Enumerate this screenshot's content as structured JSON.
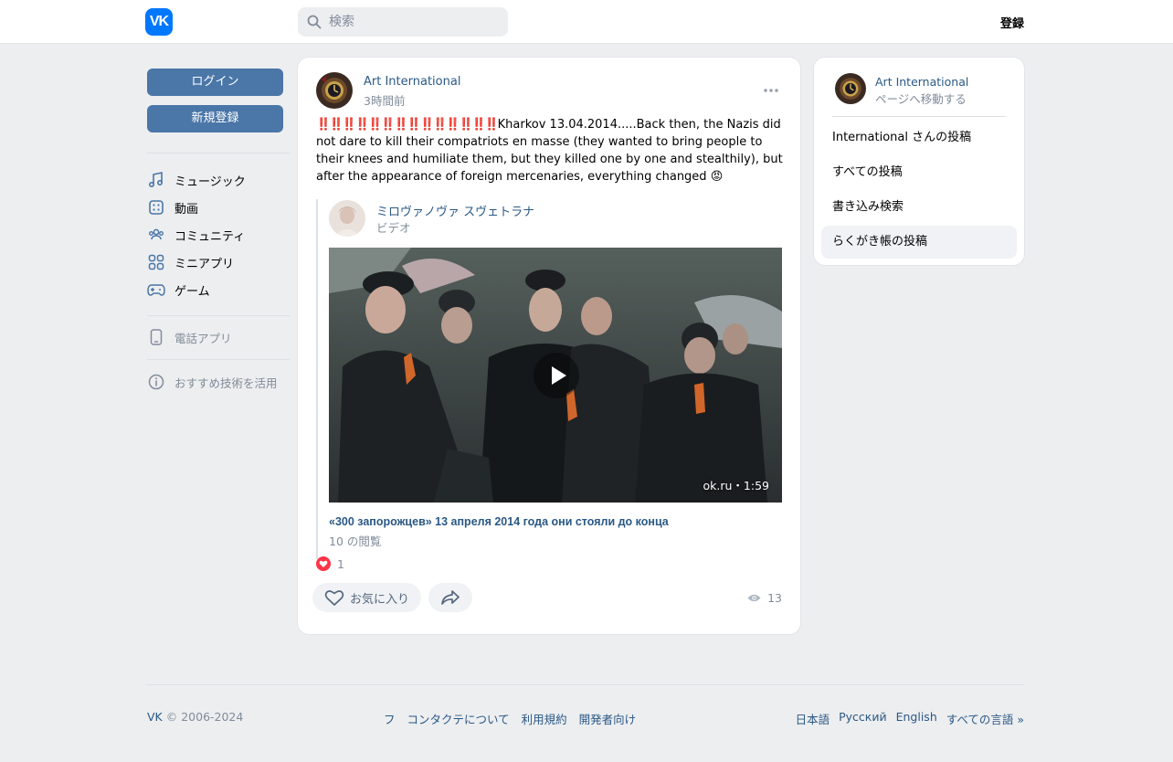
{
  "header": {
    "logo_text": "VK",
    "search_placeholder": "検索",
    "register_label": "登録"
  },
  "left_nav": {
    "login_label": "ログイン",
    "signup_label": "新規登録",
    "items": [
      {
        "label": "ミュージック",
        "icon": "music-icon"
      },
      {
        "label": "動画",
        "icon": "video-icon"
      },
      {
        "label": "コミュニティ",
        "icon": "community-icon"
      },
      {
        "label": "ミニアプリ",
        "icon": "mini-apps-icon"
      },
      {
        "label": "ゲーム",
        "icon": "gamepad-icon"
      }
    ],
    "phone_app_label": "電話アプリ",
    "recommend_label": "おすすめ技術を活用"
  },
  "post": {
    "author": "Art International",
    "time": "3時間前",
    "bangs": "‼️‼️‼️‼️‼️‼️‼️‼️‼️‼️‼️‼️‼️‼️",
    "text": "Kharkov 13.04.2014.....Back then, the Nazis did not dare to kill their compatriots en masse (they wanted to bring people to their knees and humiliate them, but they killed one by one and stealthily), but after the appearance of foreign mercenaries, everything changed",
    "angry_emoji": "😡",
    "repost": {
      "author": "ミロヴァノヴァ スヴェトラナ",
      "subtitle": "ビデオ"
    },
    "video": {
      "meta": "ok.ru・1:59",
      "title": "«300 запорожцев» 13 апреля 2014 года они стояли до конца",
      "views": "10 の閲覧"
    },
    "reaction_count": "1",
    "like_label": "お気に入り",
    "views_count": "13"
  },
  "sidebar": {
    "page_name": "Art International",
    "page_link": "ページへ移動する",
    "links": [
      "International さんの投稿",
      "すべての投稿",
      "書き込み検索",
      "らくがき帳の投稿"
    ]
  },
  "footer": {
    "copyright_vk": "VK",
    "copyright_years": "© 2006-2024",
    "middle_links": [
      "フ",
      "コンタクテについて",
      "利用規約",
      "開発者向け"
    ],
    "languages": [
      "日本語",
      "Русский",
      "English",
      "すべての言語 »"
    ]
  },
  "colors": {
    "accent": "#4a76a8",
    "link": "#2a5885",
    "brand": "#0077ff",
    "muted": "#818c99",
    "page_bg": "#edeef0"
  }
}
